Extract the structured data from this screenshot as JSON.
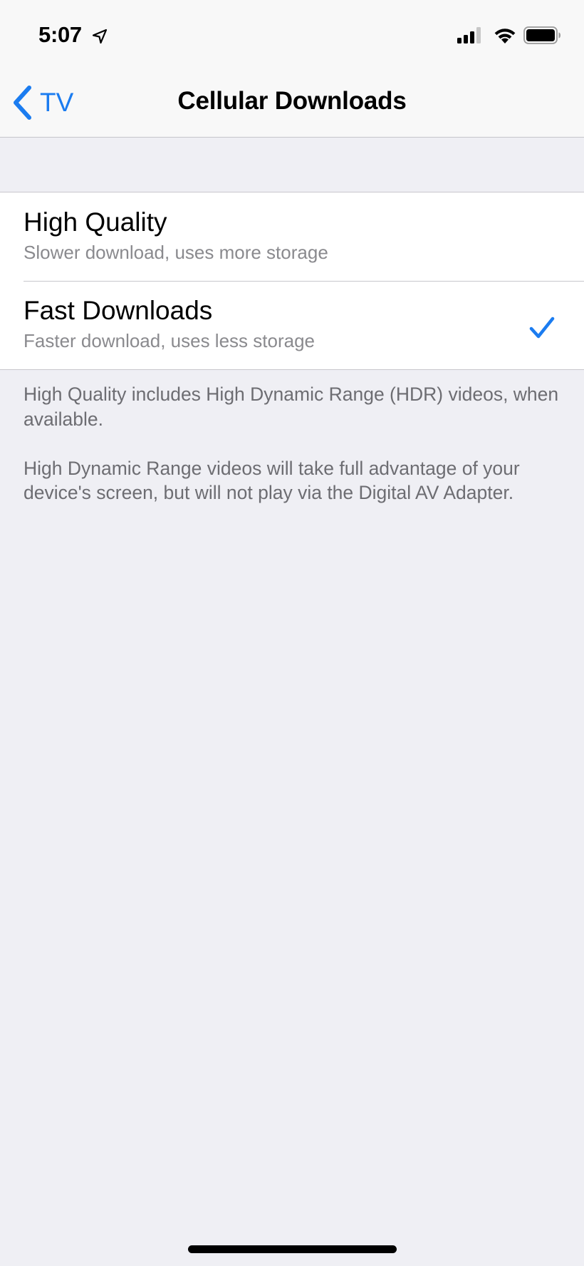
{
  "status_bar": {
    "time": "5:07",
    "icons": [
      "location-arrow-icon",
      "cellular-signal-icon",
      "wifi-icon",
      "battery-icon"
    ],
    "signal_bars_active": 3,
    "signal_bars_total": 4,
    "battery_level": 1.0
  },
  "nav": {
    "back_icon": "chevron-left-icon",
    "back_label": "TV",
    "title": "Cellular Downloads"
  },
  "options": [
    {
      "title": "High Quality",
      "subtitle": "Slower download, uses more storage",
      "selected": false
    },
    {
      "title": "Fast Downloads",
      "subtitle": "Faster download, uses less storage",
      "selected": true
    }
  ],
  "footer": {
    "paragraphs": [
      "High Quality includes High Dynamic Range (HDR) videos, when available.",
      "High Dynamic Range videos will take full advantage of your device's screen, but will not play via the Digital AV Adapter."
    ]
  },
  "colors": {
    "accent": "#1b7cf0",
    "background": "#efeff4",
    "nav_background": "#f8f8f8",
    "separator": "#c8c7cc",
    "subtitle_text": "#8a8a8e",
    "footer_text": "#6d6d72"
  }
}
